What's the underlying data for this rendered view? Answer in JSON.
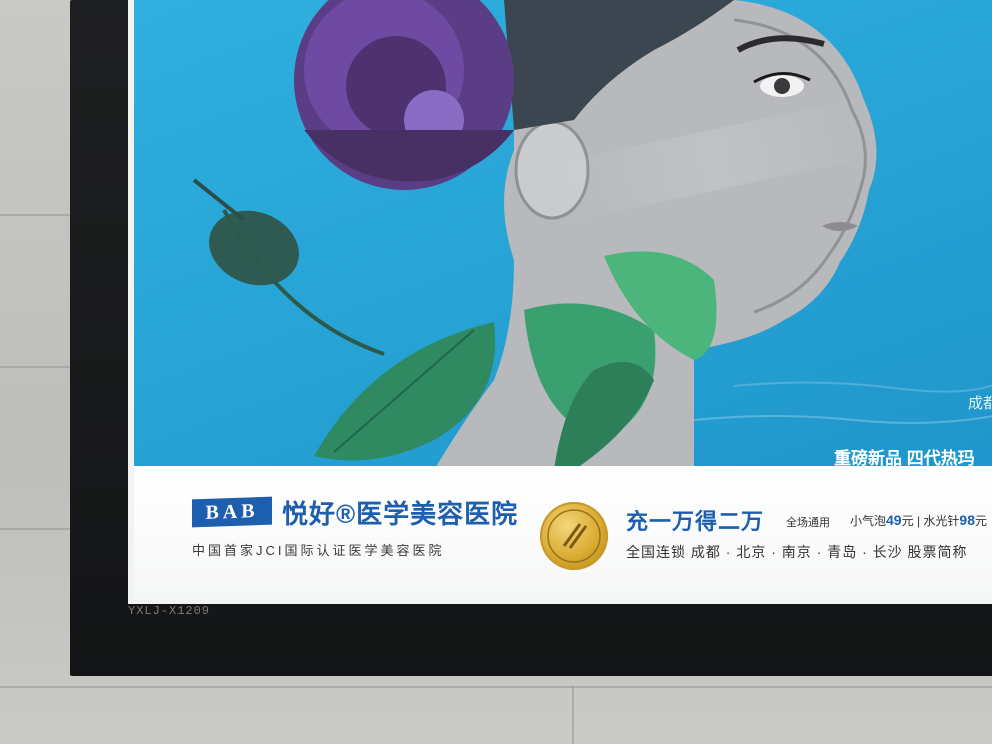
{
  "band": {
    "logo_text": "BAB",
    "brand_name": "悦好®医学美容医院",
    "brand_subtitle": "中国首家JCI国际认证医学美容医院",
    "offer_main": "充一万得二万",
    "offer_note": "全场通用",
    "price_1_label": "小气泡",
    "price_1_value": "49",
    "price_1_unit": "元",
    "price_sep": " | ",
    "price_2_label": "水光针",
    "price_2_value": "98",
    "price_2_unit": "元",
    "locations": "全国连锁 成都 · 北京 · 南京 · 青岛 · 长沙   股票简称"
  },
  "image_text": {
    "headline_prefix": "重磅新品 ",
    "headline_bold": "四代热玛",
    "city_partial": "成都"
  },
  "frame": {
    "model_label": "YXLJ-X1209"
  },
  "colors": {
    "brand_blue": "#1d5fae",
    "poster_sky": "#2ba9da",
    "seal_gold": "#d8a92f"
  }
}
